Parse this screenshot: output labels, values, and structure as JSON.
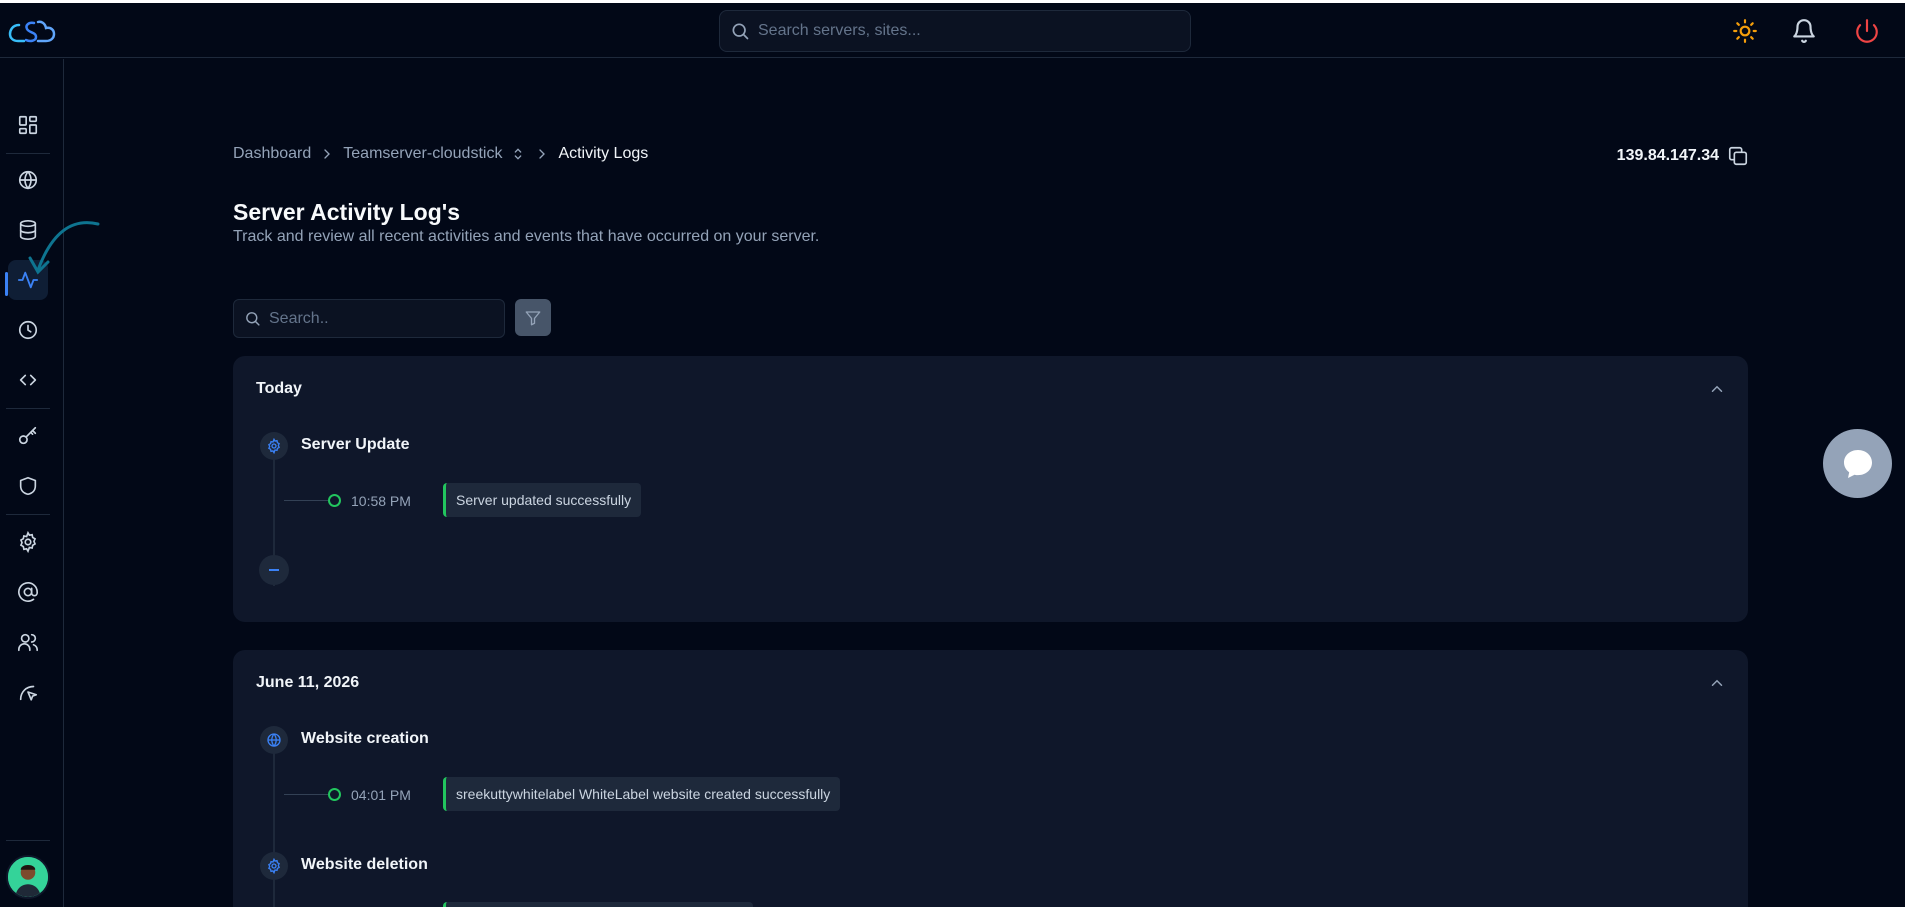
{
  "topbar": {
    "search_placeholder": "Search servers, sites...",
    "icons": [
      "sun-icon",
      "bell-icon",
      "power-icon"
    ]
  },
  "sidebar": {
    "items": [
      {
        "name": "dashboard",
        "icon": "grid-icon"
      },
      {
        "name": "websites",
        "icon": "globe-icon"
      },
      {
        "name": "databases",
        "icon": "database-icon"
      },
      {
        "name": "activity-logs",
        "icon": "activity-icon",
        "active": true
      },
      {
        "name": "cron-jobs",
        "icon": "clock-icon"
      },
      {
        "name": "code",
        "icon": "code-icon"
      },
      {
        "name": "ssh-keys",
        "icon": "key-icon"
      },
      {
        "name": "security",
        "icon": "shield-icon"
      },
      {
        "name": "settings",
        "icon": "gear-icon"
      },
      {
        "name": "email",
        "icon": "at-sign-icon"
      },
      {
        "name": "team",
        "icon": "users-icon"
      },
      {
        "name": "tools",
        "icon": "cursor-icon"
      }
    ]
  },
  "breadcrumb": {
    "home": "Dashboard",
    "server": "Teamserver-cloudstick",
    "current": "Activity Logs"
  },
  "server_ip": "139.84.147.34",
  "page": {
    "title": "Server Activity Log's",
    "subtitle": "Track and review all recent activities and events that have occurred on your server."
  },
  "log_search": {
    "placeholder": "Search.."
  },
  "groups": [
    {
      "label": "Today",
      "events": [
        {
          "title": "Server Update",
          "icon": "gear-icon",
          "time": "10:58 PM",
          "message": "Server updated successfully"
        }
      ]
    },
    {
      "label": "June 11, 2026",
      "events": [
        {
          "title": "Website creation",
          "icon": "globe-icon",
          "time": "04:01 PM",
          "message": "sreekuttywhitelabel WhiteLabel website created successfully"
        },
        {
          "title": "Website deletion",
          "icon": "gear-icon"
        }
      ]
    }
  ],
  "colors": {
    "background": "#020817",
    "card": "#0f172a",
    "accent": "#3b82f6",
    "success": "#22c55e",
    "sun": "#f59e0b",
    "power": "#ef4444"
  }
}
